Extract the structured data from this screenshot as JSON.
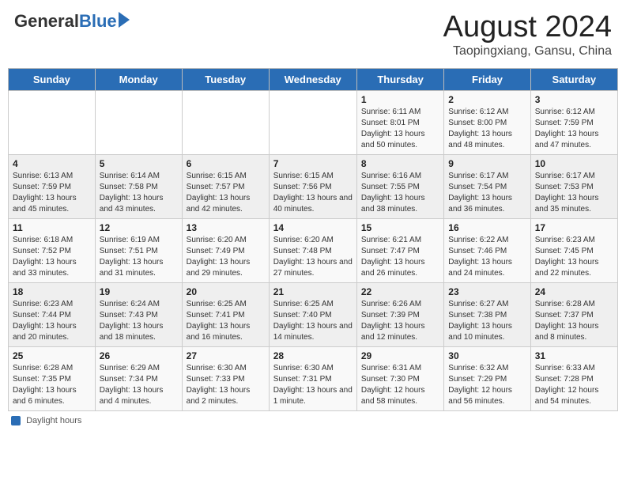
{
  "header": {
    "logo_general": "General",
    "logo_blue": "Blue",
    "main_title": "August 2024",
    "subtitle": "Taopingxiang, Gansu, China"
  },
  "days_of_week": [
    "Sunday",
    "Monday",
    "Tuesday",
    "Wednesday",
    "Thursday",
    "Friday",
    "Saturday"
  ],
  "weeks": [
    [
      {
        "day": "",
        "sunrise": "",
        "sunset": "",
        "daylight": ""
      },
      {
        "day": "",
        "sunrise": "",
        "sunset": "",
        "daylight": ""
      },
      {
        "day": "",
        "sunrise": "",
        "sunset": "",
        "daylight": ""
      },
      {
        "day": "",
        "sunrise": "",
        "sunset": "",
        "daylight": ""
      },
      {
        "day": "1",
        "sunrise": "Sunrise: 6:11 AM",
        "sunset": "Sunset: 8:01 PM",
        "daylight": "Daylight: 13 hours and 50 minutes."
      },
      {
        "day": "2",
        "sunrise": "Sunrise: 6:12 AM",
        "sunset": "Sunset: 8:00 PM",
        "daylight": "Daylight: 13 hours and 48 minutes."
      },
      {
        "day": "3",
        "sunrise": "Sunrise: 6:12 AM",
        "sunset": "Sunset: 7:59 PM",
        "daylight": "Daylight: 13 hours and 47 minutes."
      }
    ],
    [
      {
        "day": "4",
        "sunrise": "Sunrise: 6:13 AM",
        "sunset": "Sunset: 7:59 PM",
        "daylight": "Daylight: 13 hours and 45 minutes."
      },
      {
        "day": "5",
        "sunrise": "Sunrise: 6:14 AM",
        "sunset": "Sunset: 7:58 PM",
        "daylight": "Daylight: 13 hours and 43 minutes."
      },
      {
        "day": "6",
        "sunrise": "Sunrise: 6:15 AM",
        "sunset": "Sunset: 7:57 PM",
        "daylight": "Daylight: 13 hours and 42 minutes."
      },
      {
        "day": "7",
        "sunrise": "Sunrise: 6:15 AM",
        "sunset": "Sunset: 7:56 PM",
        "daylight": "Daylight: 13 hours and 40 minutes."
      },
      {
        "day": "8",
        "sunrise": "Sunrise: 6:16 AM",
        "sunset": "Sunset: 7:55 PM",
        "daylight": "Daylight: 13 hours and 38 minutes."
      },
      {
        "day": "9",
        "sunrise": "Sunrise: 6:17 AM",
        "sunset": "Sunset: 7:54 PM",
        "daylight": "Daylight: 13 hours and 36 minutes."
      },
      {
        "day": "10",
        "sunrise": "Sunrise: 6:17 AM",
        "sunset": "Sunset: 7:53 PM",
        "daylight": "Daylight: 13 hours and 35 minutes."
      }
    ],
    [
      {
        "day": "11",
        "sunrise": "Sunrise: 6:18 AM",
        "sunset": "Sunset: 7:52 PM",
        "daylight": "Daylight: 13 hours and 33 minutes."
      },
      {
        "day": "12",
        "sunrise": "Sunrise: 6:19 AM",
        "sunset": "Sunset: 7:51 PM",
        "daylight": "Daylight: 13 hours and 31 minutes."
      },
      {
        "day": "13",
        "sunrise": "Sunrise: 6:20 AM",
        "sunset": "Sunset: 7:49 PM",
        "daylight": "Daylight: 13 hours and 29 minutes."
      },
      {
        "day": "14",
        "sunrise": "Sunrise: 6:20 AM",
        "sunset": "Sunset: 7:48 PM",
        "daylight": "Daylight: 13 hours and 27 minutes."
      },
      {
        "day": "15",
        "sunrise": "Sunrise: 6:21 AM",
        "sunset": "Sunset: 7:47 PM",
        "daylight": "Daylight: 13 hours and 26 minutes."
      },
      {
        "day": "16",
        "sunrise": "Sunrise: 6:22 AM",
        "sunset": "Sunset: 7:46 PM",
        "daylight": "Daylight: 13 hours and 24 minutes."
      },
      {
        "day": "17",
        "sunrise": "Sunrise: 6:23 AM",
        "sunset": "Sunset: 7:45 PM",
        "daylight": "Daylight: 13 hours and 22 minutes."
      }
    ],
    [
      {
        "day": "18",
        "sunrise": "Sunrise: 6:23 AM",
        "sunset": "Sunset: 7:44 PM",
        "daylight": "Daylight: 13 hours and 20 minutes."
      },
      {
        "day": "19",
        "sunrise": "Sunrise: 6:24 AM",
        "sunset": "Sunset: 7:43 PM",
        "daylight": "Daylight: 13 hours and 18 minutes."
      },
      {
        "day": "20",
        "sunrise": "Sunrise: 6:25 AM",
        "sunset": "Sunset: 7:41 PM",
        "daylight": "Daylight: 13 hours and 16 minutes."
      },
      {
        "day": "21",
        "sunrise": "Sunrise: 6:25 AM",
        "sunset": "Sunset: 7:40 PM",
        "daylight": "Daylight: 13 hours and 14 minutes."
      },
      {
        "day": "22",
        "sunrise": "Sunrise: 6:26 AM",
        "sunset": "Sunset: 7:39 PM",
        "daylight": "Daylight: 13 hours and 12 minutes."
      },
      {
        "day": "23",
        "sunrise": "Sunrise: 6:27 AM",
        "sunset": "Sunset: 7:38 PM",
        "daylight": "Daylight: 13 hours and 10 minutes."
      },
      {
        "day": "24",
        "sunrise": "Sunrise: 6:28 AM",
        "sunset": "Sunset: 7:37 PM",
        "daylight": "Daylight: 13 hours and 8 minutes."
      }
    ],
    [
      {
        "day": "25",
        "sunrise": "Sunrise: 6:28 AM",
        "sunset": "Sunset: 7:35 PM",
        "daylight": "Daylight: 13 hours and 6 minutes."
      },
      {
        "day": "26",
        "sunrise": "Sunrise: 6:29 AM",
        "sunset": "Sunset: 7:34 PM",
        "daylight": "Daylight: 13 hours and 4 minutes."
      },
      {
        "day": "27",
        "sunrise": "Sunrise: 6:30 AM",
        "sunset": "Sunset: 7:33 PM",
        "daylight": "Daylight: 13 hours and 2 minutes."
      },
      {
        "day": "28",
        "sunrise": "Sunrise: 6:30 AM",
        "sunset": "Sunset: 7:31 PM",
        "daylight": "Daylight: 13 hours and 1 minute."
      },
      {
        "day": "29",
        "sunrise": "Sunrise: 6:31 AM",
        "sunset": "Sunset: 7:30 PM",
        "daylight": "Daylight: 12 hours and 58 minutes."
      },
      {
        "day": "30",
        "sunrise": "Sunrise: 6:32 AM",
        "sunset": "Sunset: 7:29 PM",
        "daylight": "Daylight: 12 hours and 56 minutes."
      },
      {
        "day": "31",
        "sunrise": "Sunrise: 6:33 AM",
        "sunset": "Sunset: 7:28 PM",
        "daylight": "Daylight: 12 hours and 54 minutes."
      }
    ]
  ],
  "footer": {
    "daylight_label": "Daylight hours"
  }
}
